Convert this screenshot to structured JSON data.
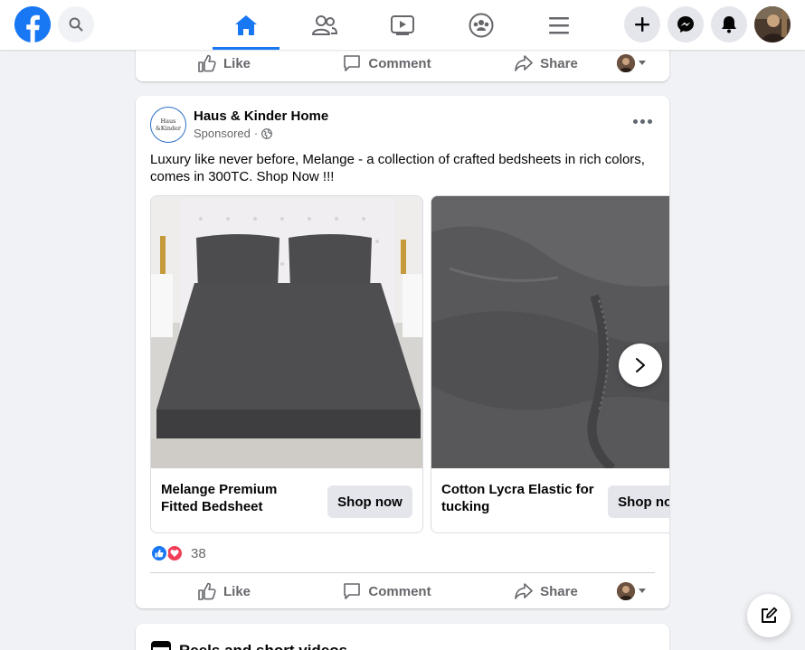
{
  "topbar": {
    "logo_icon": "facebook-logo-icon",
    "search_icon": "search-icon",
    "tabs": [
      {
        "name": "home",
        "icon": "home-icon",
        "active": true
      },
      {
        "name": "friends",
        "icon": "friends-icon",
        "active": false
      },
      {
        "name": "watch",
        "icon": "video-icon",
        "active": false
      },
      {
        "name": "groups",
        "icon": "groups-icon",
        "active": false
      },
      {
        "name": "menu",
        "icon": "menu-icon",
        "active": false
      }
    ],
    "right_icons": [
      "plus-icon",
      "messenger-icon",
      "notifications-icon",
      "account-avatar"
    ]
  },
  "previous_post": {
    "like_label": "Like",
    "comment_label": "Comment",
    "share_label": "Share"
  },
  "ad_post": {
    "page_avatar_text": "Haus & Kinder",
    "page_name": "Haus & Kinder Home",
    "sponsored_label": "Sponsored",
    "separator": "·",
    "text": "Luxury like never before, Melange - a collection of crafted bedsheets in rich colors, comes in 300TC. Shop Now !!!",
    "carousel": [
      {
        "title": "Melange Premium Fitted Bedsheet",
        "button": "Shop now"
      },
      {
        "title": "Cotton Lycra Elastic for tucking",
        "button": "Shop now"
      }
    ],
    "reaction_count": "38",
    "like_label": "Like",
    "comment_label": "Comment",
    "share_label": "Share"
  },
  "next_post": {
    "title": "Reels and short videos"
  },
  "colors": {
    "brand": "#1877f2",
    "background": "#f0f2f5",
    "secondary_text": "#65676b",
    "love": "#f33e58"
  }
}
